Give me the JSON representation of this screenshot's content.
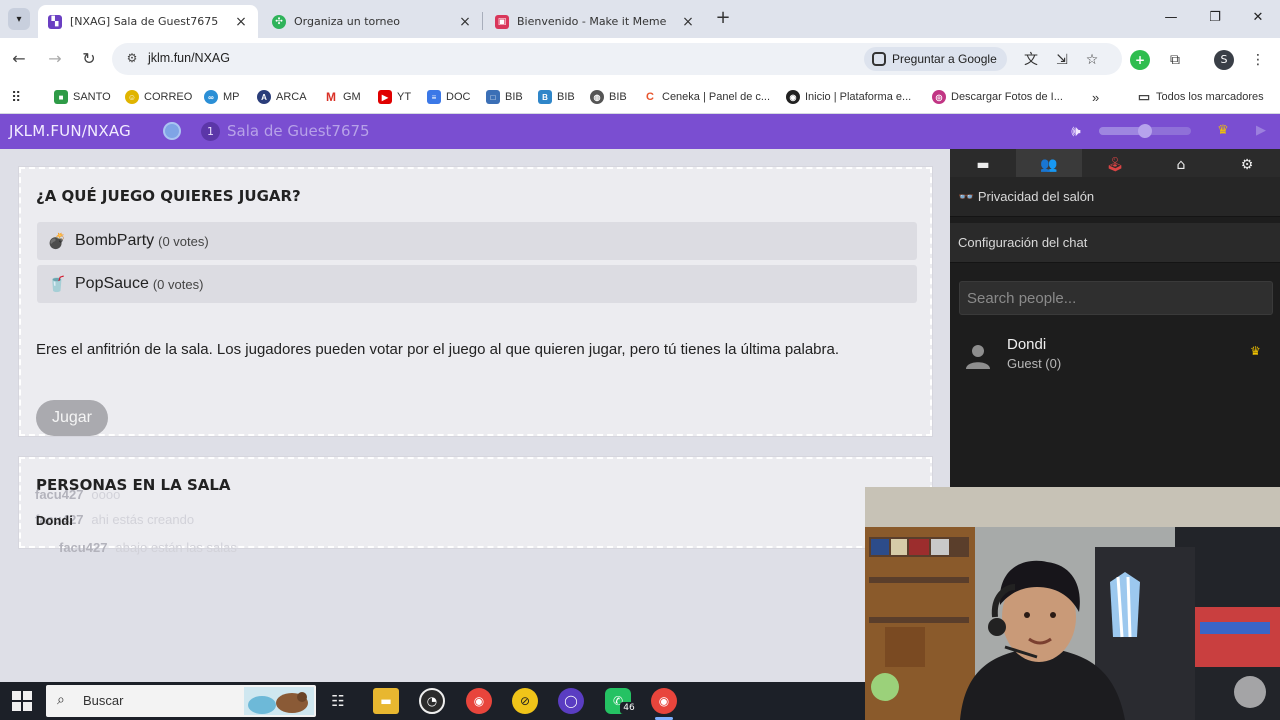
{
  "browser": {
    "tabs": [
      {
        "title": "[NXAG] Sala de Guest7675",
        "icon": "jklm-icon",
        "active": true,
        "color": "#6a3fc2"
      },
      {
        "title": "Organiza un torneo",
        "icon": "clover-icon",
        "active": false,
        "color": "#2fb35a"
      },
      {
        "title": "Bienvenido - Make it Meme",
        "icon": "meme-icon",
        "active": false,
        "color": "#d9365a"
      }
    ],
    "url": "jklm.fun/NXAG",
    "ask_google": "Preguntar a Google",
    "profile_initial": "S",
    "bookmarks": [
      {
        "label": "SANTO",
        "icon": "folder-green-icon",
        "color": "#2e9b47"
      },
      {
        "label": "CORREO",
        "icon": "smiley-icon",
        "color": "#e0b400"
      },
      {
        "label": "MP",
        "icon": "mercadopago-icon",
        "color": "#2b8fd6"
      },
      {
        "label": "ARCA",
        "icon": "arca-icon",
        "color": "#2a3d7a"
      },
      {
        "label": "GM",
        "icon": "gmail-icon",
        "color": "#d93025"
      },
      {
        "label": "YT",
        "icon": "youtube-icon",
        "color": "#e00000"
      },
      {
        "label": "DOC",
        "icon": "docs-icon",
        "color": "#3b78e7"
      },
      {
        "label": "BIB",
        "icon": "bib-icon",
        "color": "#3b6fb6"
      },
      {
        "label": "BIB",
        "icon": "bib-b-icon",
        "color": "#2f86c9"
      },
      {
        "label": "BIB",
        "icon": "globe-icon",
        "color": "#555555"
      },
      {
        "label": "Ceneka | Panel de c...",
        "icon": "ceneka-icon",
        "color": "#e8542c"
      },
      {
        "label": "Inicio | Plataforma e...",
        "icon": "platform-icon",
        "color": "#222222"
      },
      {
        "label": "Descargar Fotos de I...",
        "icon": "instagram-icon",
        "color": "#c13584"
      }
    ],
    "all_bookmarks": "Todos los marcadores"
  },
  "header": {
    "site": "JKLM.FUN/NXAG",
    "room_number": "1",
    "room_name": "Sala de Guest7675",
    "volume_level": 0.5,
    "accent_color": "#7a4ed1"
  },
  "vote_card": {
    "title": "¿A QUÉ JUEGO QUIERES JUGAR?",
    "games": [
      {
        "name": "BombParty",
        "votes": "(0 votes)",
        "icon": "bomb-icon"
      },
      {
        "name": "PopSauce",
        "votes": "(0 votes)",
        "icon": "popsauce-icon"
      }
    ],
    "host_message": "Eres el anfitrión de la sala. Los jugadores pueden votar por el juego al que quieren jugar, pero tú tienes la última palabra.",
    "play_button": "Jugar"
  },
  "people_card": {
    "title": "PERSONAS EN LA SALA",
    "chat_overlay": [
      {
        "name": "facu427",
        "message": "oooo"
      },
      {
        "name": "facu427",
        "message": "ahi estás creando"
      },
      {
        "name": "facu427",
        "message": "abajo están las salas"
      }
    ],
    "host_name": "Dondi"
  },
  "sidebar": {
    "tabs": [
      "chat-icon",
      "people-icon",
      "joystick-icon",
      "home-icon",
      "gear-icon"
    ],
    "privacy_label": "Privacidad del salón",
    "chat_config_label": "Configuración del chat",
    "search_placeholder": "Search people...",
    "people": [
      {
        "name": "Dondi",
        "role": "Guest (0)",
        "is_host": true
      }
    ]
  },
  "taskbar": {
    "search_label": "Buscar",
    "whatsapp_badge": "46"
  }
}
